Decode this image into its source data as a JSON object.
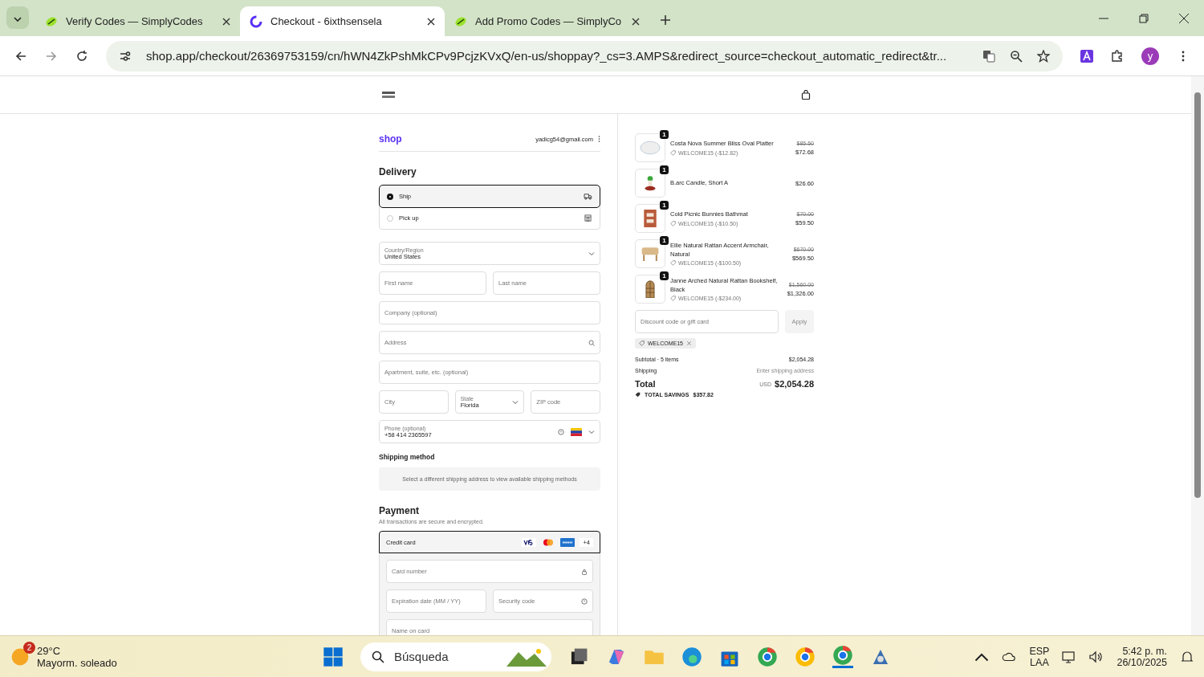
{
  "browser": {
    "tabs": [
      {
        "title": "Verify Codes — SimplyCodes",
        "selected": false,
        "kind": "simplycodes"
      },
      {
        "title": "Checkout - 6ixthsensela",
        "selected": true,
        "kind": "shop"
      },
      {
        "title": "Add Promo Codes — SimplyCo",
        "selected": false,
        "kind": "simplycodes"
      }
    ],
    "url": "shop.app/checkout/26369753159/cn/hWN4ZkPshMkCPv9PcjzKVxQ/en-us/shoppay?_cs=3.AMPS&redirect_source=checkout_automatic_redirect&tr...",
    "profile": "y"
  },
  "shop": {
    "brand": "shop",
    "email": "yadicg54@gmail.com"
  },
  "delivery": {
    "title": "Delivery",
    "options": [
      {
        "label": "Ship",
        "selected": true,
        "kind": "ship"
      },
      {
        "label": "Pick up",
        "selected": false,
        "kind": "pickup"
      }
    ]
  },
  "address_rows": [
    [
      {
        "kind": "select",
        "label": "Country/Region",
        "value": "United States"
      }
    ],
    [
      {
        "kind": "text",
        "placeholder": "First name"
      },
      {
        "kind": "text",
        "placeholder": "Last name"
      }
    ],
    [
      {
        "kind": "text",
        "placeholder": "Company (optional)"
      }
    ],
    [
      {
        "kind": "search",
        "placeholder": "Address"
      }
    ],
    [
      {
        "kind": "text",
        "placeholder": "Apartment, suite, etc. (optional)"
      }
    ],
    [
      {
        "kind": "text",
        "placeholder": "City"
      },
      {
        "kind": "select",
        "label": "State",
        "value": "Florida"
      },
      {
        "kind": "text",
        "placeholder": "ZIP code"
      }
    ],
    [
      {
        "kind": "phone",
        "label": "Phone (optional)",
        "value": "+58 414 2365597"
      }
    ]
  ],
  "shipping_method": {
    "title": "Shipping method",
    "message": "Select a different shipping address to view available shipping methods"
  },
  "payment": {
    "title": "Payment",
    "subtitle": "All transactions are secure and encrypted.",
    "method": {
      "label": "Credit card",
      "selected": true,
      "more_brands": "+4"
    },
    "fields": [
      [
        {
          "kind": "lock",
          "placeholder": "Card number"
        }
      ],
      [
        {
          "kind": "text",
          "placeholder": "Expiration date (MM / YY)"
        },
        {
          "kind": "help",
          "placeholder": "Security code"
        }
      ],
      [
        {
          "kind": "text",
          "placeholder": "Name on card"
        }
      ]
    ]
  },
  "summary": {
    "items": [
      {
        "kind": "platter",
        "quantity": "1",
        "name": "Costa Nova Summer Bliss Oval Platter",
        "discount": "WELCOME15 (-$12.82)",
        "original_price": "$85.50",
        "price": "$72.68"
      },
      {
        "kind": "candle",
        "quantity": "1",
        "name": "B.arc Candle, Short A",
        "price": "$26.60"
      },
      {
        "kind": "bathmat",
        "quantity": "1",
        "name": "Cold Picnic Bunnies Bathmat",
        "discount": "WELCOME15 (-$10.50)",
        "original_price": "$70.00",
        "price": "$59.50"
      },
      {
        "kind": "chair",
        "quantity": "1",
        "name": "Ellie Natural Rattan Accent Armchair, Natural",
        "discount": "WELCOME15 (-$100.50)",
        "original_price": "$670.00",
        "price": "$569.50"
      },
      {
        "kind": "shelf",
        "quantity": "1",
        "name": "Janne Arched Natural Rattan Bookshelf, Black",
        "discount": "WELCOME15 (-$234.00)",
        "original_price": "$1,560.00",
        "price": "$1,326.00"
      }
    ],
    "discount_placeholder": "Discount code or gift card",
    "apply": "Apply",
    "applied_code": "WELCOME15",
    "subtotal_label": "Subtotal · 5 items",
    "subtotal": "$2,054.28",
    "shipping_label": "Shipping",
    "shipping": "Enter shipping address",
    "total_label": "Total",
    "currency": "USD",
    "total": "$2,054.28",
    "savings_label": "TOTAL SAVINGS",
    "savings": "$357.82"
  },
  "taskbar": {
    "weather_badge": "2",
    "temperature": "29°C",
    "weather": "Mayorm. soleado",
    "search": "Búsqueda",
    "lang": "ESP",
    "layout": "LAA",
    "time": "5:42 p. m.",
    "date": "26/10/2025"
  }
}
